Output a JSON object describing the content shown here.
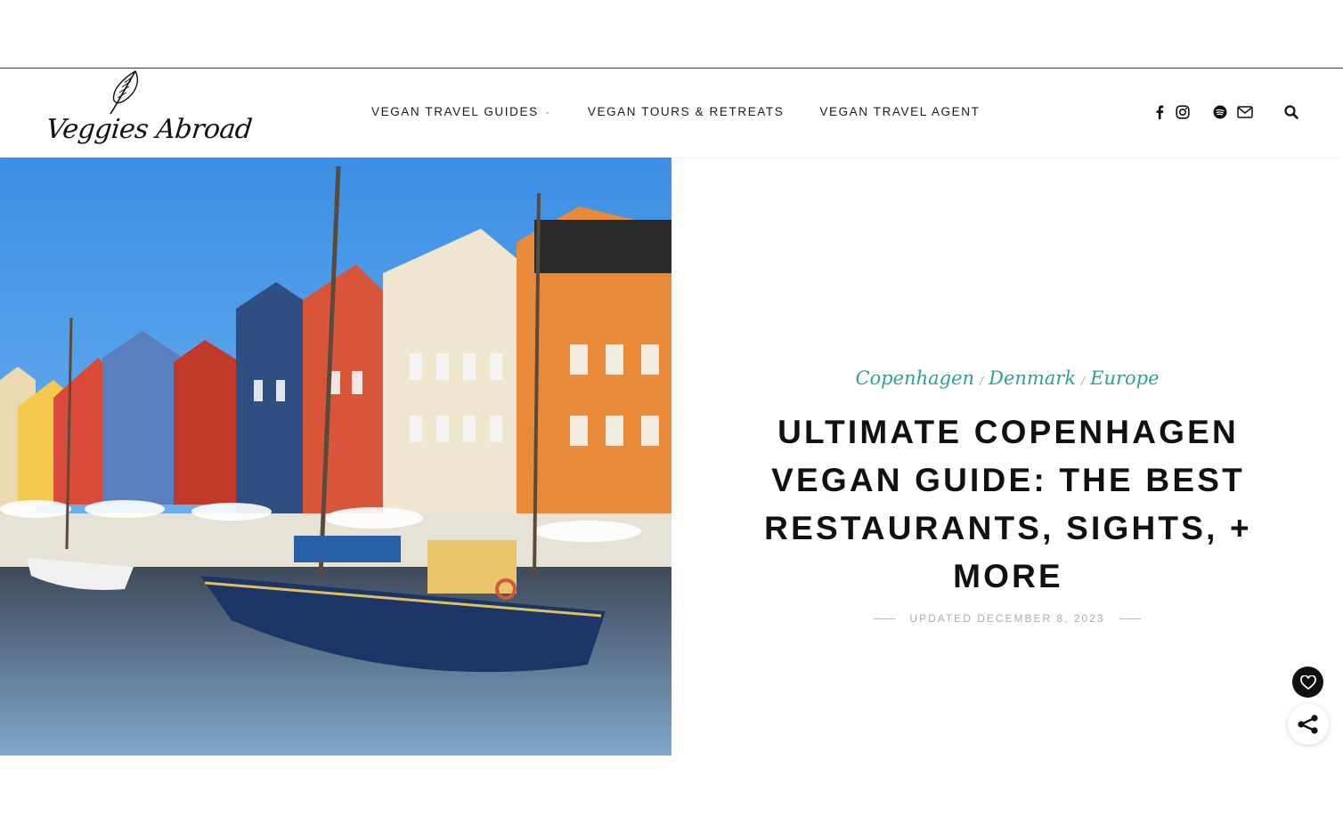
{
  "site": {
    "logo_text": "Veggies Abroad"
  },
  "nav": {
    "items": [
      {
        "label": "VEGAN TRAVEL GUIDES",
        "has_dropdown": true
      },
      {
        "label": "VEGAN TOURS & RETREATS",
        "has_dropdown": false
      },
      {
        "label": "VEGAN TRAVEL AGENT",
        "has_dropdown": false
      }
    ]
  },
  "social": {
    "icons": [
      "facebook-icon",
      "instagram-icon",
      "spotify-icon",
      "email-icon"
    ],
    "search_icon": "search-icon"
  },
  "hero": {
    "image_subject": "Colorful harbor houses and a blue wooden sailboat at Nyhavn, Copenhagen"
  },
  "article": {
    "categories": [
      "Copenhagen",
      "Denmark",
      "Europe"
    ],
    "category_separator": "/",
    "title": "ULTIMATE COPENHAGEN VEGAN GUIDE: THE BEST RESTAURANTS, SIGHTS, + MORE",
    "updated": "UPDATED DECEMBER 8, 2023"
  },
  "floating": {
    "favorite_icon": "heart-icon",
    "share_icon": "share-icon"
  },
  "colors": {
    "accent": "#2aa19a",
    "text": "#111111",
    "muted": "#aaaaaa"
  }
}
